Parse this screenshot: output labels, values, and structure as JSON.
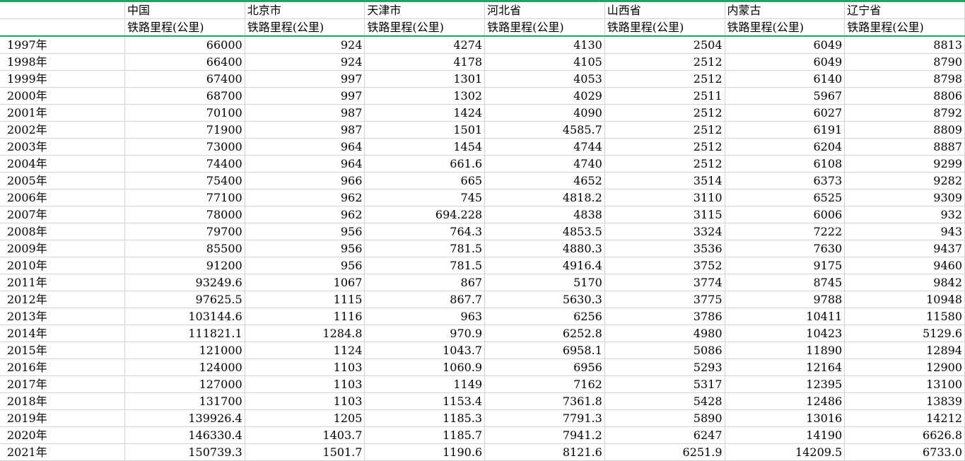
{
  "sheet": {
    "regions": [
      "中国",
      "北京市",
      "天津市",
      "河北省",
      "山西省",
      "内蒙古",
      "辽宁省"
    ],
    "metric": "铁路里程(公里)",
    "rows": [
      {
        "year": "1997年",
        "values": [
          "66000",
          "924",
          "4274",
          "4130",
          "2504",
          "6049",
          "8813"
        ]
      },
      {
        "year": "1998年",
        "values": [
          "66400",
          "924",
          "4178",
          "4105",
          "2512",
          "6049",
          "8790"
        ]
      },
      {
        "year": "1999年",
        "values": [
          "67400",
          "997",
          "1301",
          "4053",
          "2512",
          "6140",
          "8798"
        ]
      },
      {
        "year": "2000年",
        "values": [
          "68700",
          "997",
          "1302",
          "4029",
          "2511",
          "5967",
          "8806"
        ]
      },
      {
        "year": "2001年",
        "values": [
          "70100",
          "987",
          "1424",
          "4090",
          "2512",
          "6027",
          "8792"
        ]
      },
      {
        "year": "2002年",
        "values": [
          "71900",
          "987",
          "1501",
          "4585.7",
          "2512",
          "6191",
          "8809"
        ]
      },
      {
        "year": "2003年",
        "values": [
          "73000",
          "964",
          "1454",
          "4744",
          "2512",
          "6204",
          "8887"
        ]
      },
      {
        "year": "2004年",
        "values": [
          "74400",
          "964",
          "661.6",
          "4740",
          "2512",
          "6108",
          "9299"
        ]
      },
      {
        "year": "2005年",
        "values": [
          "75400",
          "966",
          "665",
          "4652",
          "3514",
          "6373",
          "9282"
        ]
      },
      {
        "year": "2006年",
        "values": [
          "77100",
          "962",
          "745",
          "4818.2",
          "3110",
          "6525",
          "9309"
        ]
      },
      {
        "year": "2007年",
        "values": [
          "78000",
          "962",
          "694.228",
          "4838",
          "3115",
          "6006",
          "932"
        ]
      },
      {
        "year": "2008年",
        "values": [
          "79700",
          "956",
          "764.3",
          "4853.5",
          "3324",
          "7222",
          "943"
        ]
      },
      {
        "year": "2009年",
        "values": [
          "85500",
          "956",
          "781.5",
          "4880.3",
          "3536",
          "7630",
          "9437"
        ]
      },
      {
        "year": "2010年",
        "values": [
          "91200",
          "956",
          "781.5",
          "4916.4",
          "3752",
          "9175",
          "9460"
        ]
      },
      {
        "year": "2011年",
        "values": [
          "93249.6",
          "1067",
          "867",
          "5170",
          "3774",
          "8745",
          "9842"
        ]
      },
      {
        "year": "2012年",
        "values": [
          "97625.5",
          "1115",
          "867.7",
          "5630.3",
          "3775",
          "9788",
          "10948"
        ]
      },
      {
        "year": "2013年",
        "values": [
          "103144.6",
          "1116",
          "963",
          "6256",
          "3786",
          "10411",
          "11580"
        ]
      },
      {
        "year": "2014年",
        "values": [
          "111821.1",
          "1284.8",
          "970.9",
          "6252.8",
          "4980",
          "10423",
          "5129.6"
        ]
      },
      {
        "year": "2015年",
        "values": [
          "121000",
          "1124",
          "1043.7",
          "6958.1",
          "5086",
          "11890",
          "12894"
        ]
      },
      {
        "year": "2016年",
        "values": [
          "124000",
          "1103",
          "1060.9",
          "6956",
          "5293",
          "12164",
          "12900"
        ]
      },
      {
        "year": "2017年",
        "values": [
          "127000",
          "1103",
          "1149",
          "7162",
          "5317",
          "12395",
          "13100"
        ]
      },
      {
        "year": "2018年",
        "values": [
          "131700",
          "1103",
          "1153.4",
          "7361.8",
          "5428",
          "12486",
          "13839"
        ]
      },
      {
        "year": "2019年",
        "values": [
          "139926.4",
          "1205",
          "1185.3",
          "7791.3",
          "5890",
          "13016",
          "14212"
        ]
      },
      {
        "year": "2020年",
        "values": [
          "146330.4",
          "1403.7",
          "1185.7",
          "7941.2",
          "6247",
          "14190",
          "6626.8"
        ]
      },
      {
        "year": "2021年",
        "values": [
          "150739.3",
          "1501.7",
          "1190.6",
          "8121.6",
          "6251.9",
          "14209.5",
          "6733.0"
        ]
      }
    ]
  },
  "colors": {
    "accent": "#21a366",
    "gridline": "#d4d4d4"
  }
}
